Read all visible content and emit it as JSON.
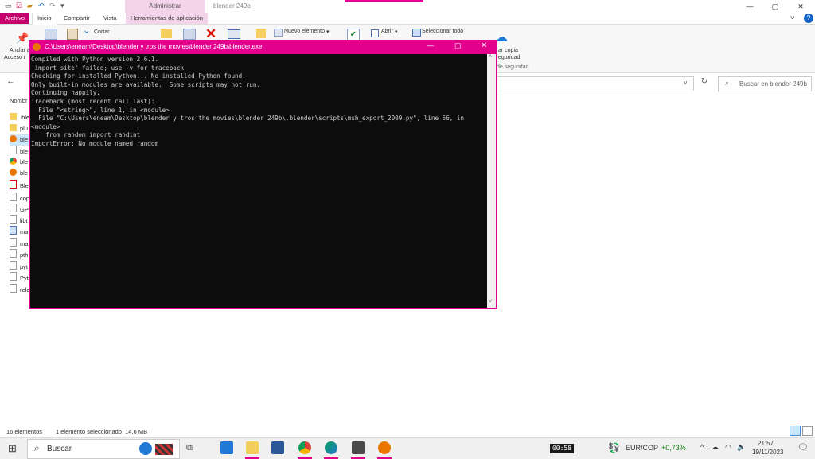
{
  "explorer": {
    "title": "blender 249b",
    "contextual_header": "Administrar",
    "tabs": [
      "Archivo",
      "Inicio",
      "Compartir",
      "Vista",
      "Herramientas de aplicación"
    ],
    "ribbon": {
      "anclar": "Anclar a",
      "acceso": "Acceso r",
      "cortar": "Cortar",
      "nuevo_elemento": "Nuevo elemento",
      "abrir": "Abrir",
      "seleccionar_todo": "Seleccionar todo",
      "copia_line1": "ar copia",
      "copia_line2": "eguridad",
      "group_label": "de seguridad"
    },
    "search_placeholder": "Buscar en blender 249b",
    "nav_header": "Nombr",
    "files": [
      ".ble",
      "plu",
      "ble",
      "ble",
      "ble",
      "ble",
      "Ble",
      "cop",
      "GPI",
      "libt",
      "ma",
      "ma",
      "pth",
      "pyt",
      "Pyt",
      "rele"
    ],
    "status": {
      "count": "16 elementos",
      "selected": "1 elemento seleccionado  14,6 MB"
    }
  },
  "console": {
    "title": "C:\\Users\\eneam\\Desktop\\blender y tros the movies\\blender 249b\\blender.exe",
    "lines": [
      "Compiled with Python version 2.6.1.",
      "'import site' failed; use -v for traceback",
      "Checking for installed Python... No installed Python found.",
      "Only built-in modules are available.  Some scripts may not run.",
      "Continuing happily.",
      "Traceback (most recent call last):",
      "  File \"<string>\", line 1, in <module>",
      "  File \"C:\\Users\\eneam\\Desktop\\blender y tros the movies\\blender 249b\\.blender\\scripts\\msh_export_2009.py\", line 56, in",
      "<module>",
      "    from random import randint",
      "ImportError: No module named random"
    ]
  },
  "taskbar": {
    "search_label": "Buscar",
    "timer": "00:58",
    "currency": "EUR/COP",
    "change": "+0,73%",
    "time": "21:57",
    "date": "19/11/2023"
  },
  "colors": {
    "accent": "#e3008c",
    "console_bg": "#0c0c0c",
    "console_fg": "#cccccc",
    "positive": "#107c10"
  }
}
